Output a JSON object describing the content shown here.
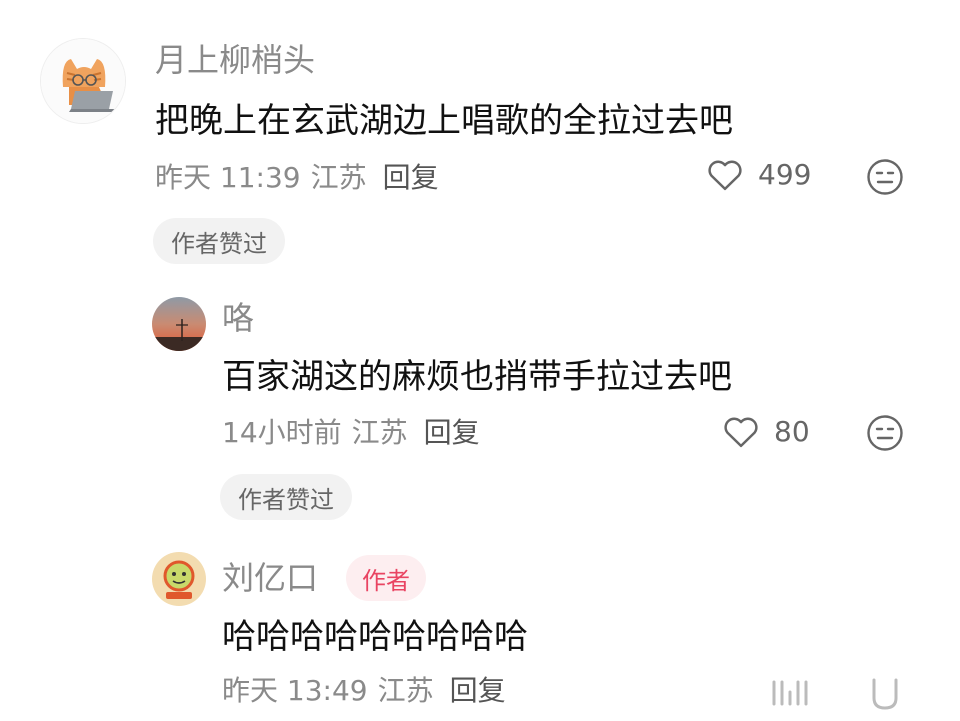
{
  "comments": [
    {
      "username": "月上柳梢头",
      "content": "把晚上在玄武湖边上唱歌的全拉过去吧",
      "time": "昨天 11:39",
      "location": "江苏",
      "reply_label": "回复",
      "likes": "499",
      "chip": "作者赞过",
      "avatar_icon": "cat-with-laptop"
    },
    {
      "username": "咯",
      "content": "百家湖这的麻烦也捎带手拉过去吧",
      "time": "14小时前",
      "location": "江苏",
      "reply_label": "回复",
      "likes": "80",
      "chip": "作者赞过",
      "avatar_icon": "sunset-landscape"
    },
    {
      "username": "刘亿口",
      "badge": "作者",
      "content": "哈哈哈哈哈哈哈哈哈",
      "time": "昨天 13:49",
      "location": "江苏",
      "reply_label": "回复",
      "avatar_icon": "cartoon-character"
    }
  ],
  "colors": {
    "text_primary": "#111111",
    "text_secondary": "#8a8a8a",
    "chip_bg": "#f2f2f2",
    "author_badge_bg": "#fdeef0",
    "author_badge_text": "#e94462"
  }
}
